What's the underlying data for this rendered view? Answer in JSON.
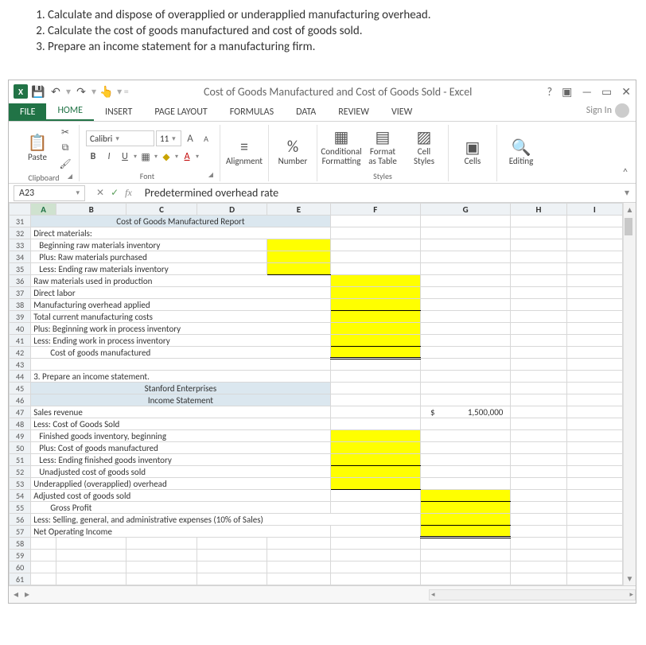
{
  "page": {
    "objectives": [
      "Calculate and dispose of overapplied or underapplied manufacturing overhead.",
      "Calculate the cost of goods manufactured and cost of goods sold.",
      "Prepare an income statement for a manufacturing firm."
    ]
  },
  "window": {
    "title": "Cost of Goods Manufactured and Cost of Goods Sold - Excel",
    "signin": "Sign In"
  },
  "tabs": {
    "file": "FILE",
    "home": "HOME",
    "insert": "INSERT",
    "page_layout": "PAGE LAYOUT",
    "formulas": "FORMULAS",
    "data": "DATA",
    "review": "REVIEW",
    "view": "VIEW"
  },
  "ribbon": {
    "clipboard": {
      "label": "Clipboard",
      "paste": "Paste"
    },
    "font": {
      "label": "Font",
      "name": "Calibri",
      "size": "11",
      "bold": "B",
      "italic": "I",
      "underline": "U"
    },
    "alignment": {
      "label": "Alignment"
    },
    "number": {
      "label": "Number",
      "symbol": "%"
    },
    "styles": {
      "label": "Styles",
      "conditional": "Conditional Formatting",
      "formatas": "Format as Table",
      "cellstyles": "Cell Styles"
    },
    "cells": {
      "label": "Cells"
    },
    "editing": {
      "label": "Editing"
    }
  },
  "formula_bar": {
    "name_box": "A23",
    "formula": "Predetermined overhead rate"
  },
  "columns": [
    "A",
    "B",
    "C",
    "D",
    "E",
    "F",
    "G",
    "H",
    "I"
  ],
  "rows": {
    "r31": {
      "title": "Cost of Goods Manufactured Report"
    },
    "r32": {
      "a": "Direct materials:"
    },
    "r33": {
      "a": "Beginning raw materials inventory"
    },
    "r34": {
      "a": "Plus: Raw materials purchased"
    },
    "r35": {
      "a": "Less: Ending raw materials inventory"
    },
    "r36": {
      "a": "Raw materials used in production"
    },
    "r37": {
      "a": "Direct labor"
    },
    "r38": {
      "a": "Manufacturing overhead applied"
    },
    "r39": {
      "a": "Total current manufacturing costs"
    },
    "r40": {
      "a": "Plus: Beginning work in process inventory"
    },
    "r41": {
      "a": "Less: Ending work in process inventory"
    },
    "r42": {
      "a": "Cost of goods manufactured"
    },
    "r44": {
      "a": "3. Prepare an income statement."
    },
    "r45": {
      "title": "Stanford Enterprises"
    },
    "r46": {
      "title": "Income Statement"
    },
    "r47": {
      "a": "Sales revenue",
      "g_sym": "$",
      "g_val": "1,500,000"
    },
    "r48": {
      "a": "Less:  Cost of Goods Sold"
    },
    "r49": {
      "a": "Finished goods inventory, beginning"
    },
    "r50": {
      "a": "Plus: Cost of goods manufactured"
    },
    "r51": {
      "a": "Less: Ending finished goods inventory"
    },
    "r52": {
      "a": "Unadjusted cost of goods sold"
    },
    "r53": {
      "a": "Underapplied (overapplied) overhead"
    },
    "r54": {
      "a": "Adjusted cost of goods sold"
    },
    "r55": {
      "a": "Gross Profit"
    },
    "r56": {
      "a": "Less:  Selling, general, and administrative expenses (10% of Sales)"
    },
    "r57": {
      "a": "Net Operating Income"
    }
  }
}
